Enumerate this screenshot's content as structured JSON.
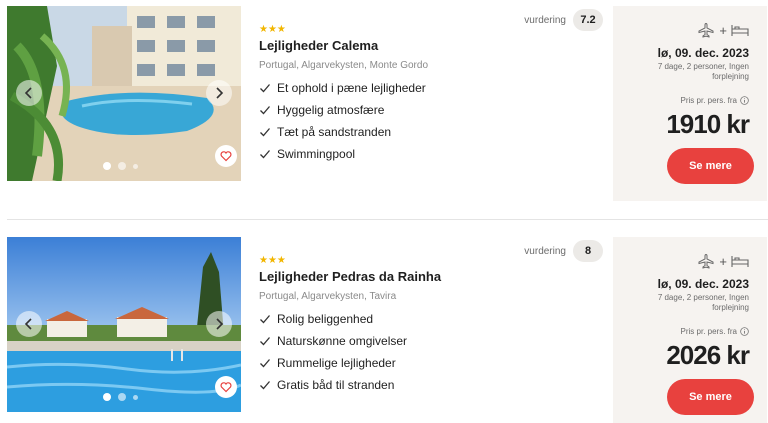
{
  "rating_label": "vurdering",
  "price_label": "Pris pr. pers. fra",
  "cta_label": "Se mere",
  "colors": {
    "cta": "#e8413e",
    "stars": "#f2b600",
    "price_box": "#f6f3f0"
  },
  "hotels": [
    {
      "stars": "★★★",
      "name": "Lejligheder Calema",
      "location": [
        "Portugal",
        "Algarvekysten",
        "Monte Gordo"
      ],
      "features": [
        "Et ophold i pæne lejligheder",
        "Hyggelig atmosfære",
        "Tæt på sandstranden",
        "Swimmingpool"
      ],
      "rating": "7.2",
      "date": "lø, 09. dec. 2023",
      "details": "7 dage, 2 personer, Ingen forplejning",
      "price": "1910 kr",
      "carousel": {
        "slides": 3,
        "active": 1
      }
    },
    {
      "stars": "★★★",
      "name": "Lejligheder Pedras da Rainha",
      "location": [
        "Portugal",
        "Algarvekysten",
        "Tavira"
      ],
      "features": [
        "Rolig beliggenhed",
        "Naturskønne omgivelser",
        "Rummelige lejligheder",
        "Gratis båd til stranden"
      ],
      "rating": "8",
      "date": "lø, 09. dec. 2023",
      "details": "7 dage, 2 personer, Ingen forplejning",
      "price": "2026 kr",
      "carousel": {
        "slides": 3,
        "active": 1
      }
    }
  ]
}
